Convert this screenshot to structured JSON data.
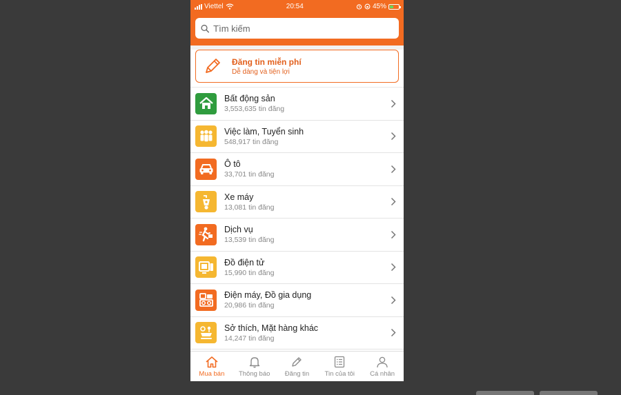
{
  "status_bar": {
    "carrier": "Viettel",
    "time": "20:54",
    "battery": "45%",
    "battery_level": 0.45
  },
  "search": {
    "placeholder": "Tìm kiếm"
  },
  "post_card": {
    "title": "Đăng tin miễn phí",
    "subtitle": "Dễ dàng và tiện lợi",
    "icon": "pencil-icon"
  },
  "count_unit": "tin đăng",
  "categories": [
    {
      "name": "Bất động sản",
      "count": "3,553,635",
      "icon": "house-icon",
      "color": "#2f9c3e"
    },
    {
      "name": "Việc làm, Tuyển sinh",
      "count": "548,917",
      "icon": "people-icon",
      "color": "#f5b731"
    },
    {
      "name": "Ô tô",
      "count": "33,701",
      "icon": "car-icon",
      "color": "#f26b21"
    },
    {
      "name": "Xe máy",
      "count": "13,081",
      "icon": "scooter-icon",
      "color": "#f5b731"
    },
    {
      "name": "Dịch vụ",
      "count": "13,539",
      "icon": "courier-icon",
      "color": "#f26b21"
    },
    {
      "name": "Đồ điện tử",
      "count": "15,990",
      "icon": "electronics-icon",
      "color": "#f5b731"
    },
    {
      "name": "Điện máy, Đồ gia dụng",
      "count": "20,986",
      "icon": "appliance-icon",
      "color": "#f26b21"
    },
    {
      "name": "Sở thích, Mặt hàng khác",
      "count": "14,247",
      "icon": "hobby-icon",
      "color": "#f5b731"
    }
  ],
  "tabs": [
    {
      "label": "Mua bán",
      "icon": "home-icon",
      "active": true
    },
    {
      "label": "Thông báo",
      "icon": "bell-icon",
      "active": false
    },
    {
      "label": "Đăng tin",
      "icon": "pencil-icon",
      "active": false
    },
    {
      "label": "Tin của tôi",
      "icon": "list-icon",
      "active": false
    },
    {
      "label": "Cá nhân",
      "icon": "person-icon",
      "active": false
    }
  ],
  "colors": {
    "brand": "#f26b21",
    "background": "#3a3a3a"
  }
}
